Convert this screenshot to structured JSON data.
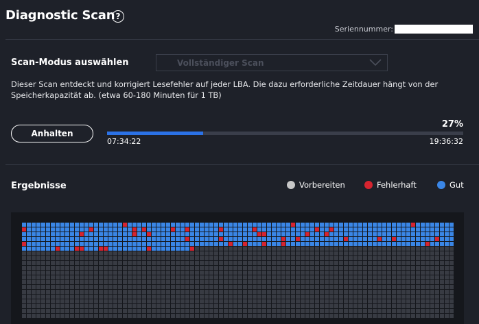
{
  "header": {
    "title": "Diagnostic Scan",
    "help_symbol": "?",
    "serial_label": "Seriennummer:"
  },
  "mode": {
    "label": "Scan-Modus auswählen",
    "selected": "Vollständiger Scan"
  },
  "description": "Dieser Scan entdeckt und korrigiert Lesefehler auf jeder LBA. Die dazu erforderliche Zeitdauer hängt von der Speicherkapazität ab. (etwa 60-180 Minuten für 1 TB)",
  "progress": {
    "stop_label": "Anhalten",
    "percent_label": "27%",
    "fraction": 0.27,
    "elapsed": "07:34:22",
    "remaining": "19:36:32"
  },
  "results": {
    "title": "Ergebnisse",
    "legend": [
      {
        "label": "Vorbereiten",
        "color": "#c7c7c7"
      },
      {
        "label": "Fehlerhaft",
        "color": "#d6242f"
      },
      {
        "label": "Gut",
        "color": "#3a86e6"
      }
    ],
    "colors": {
      "good": "#3a86e6",
      "error": "#d6242f",
      "pending": "#383b43"
    }
  }
}
